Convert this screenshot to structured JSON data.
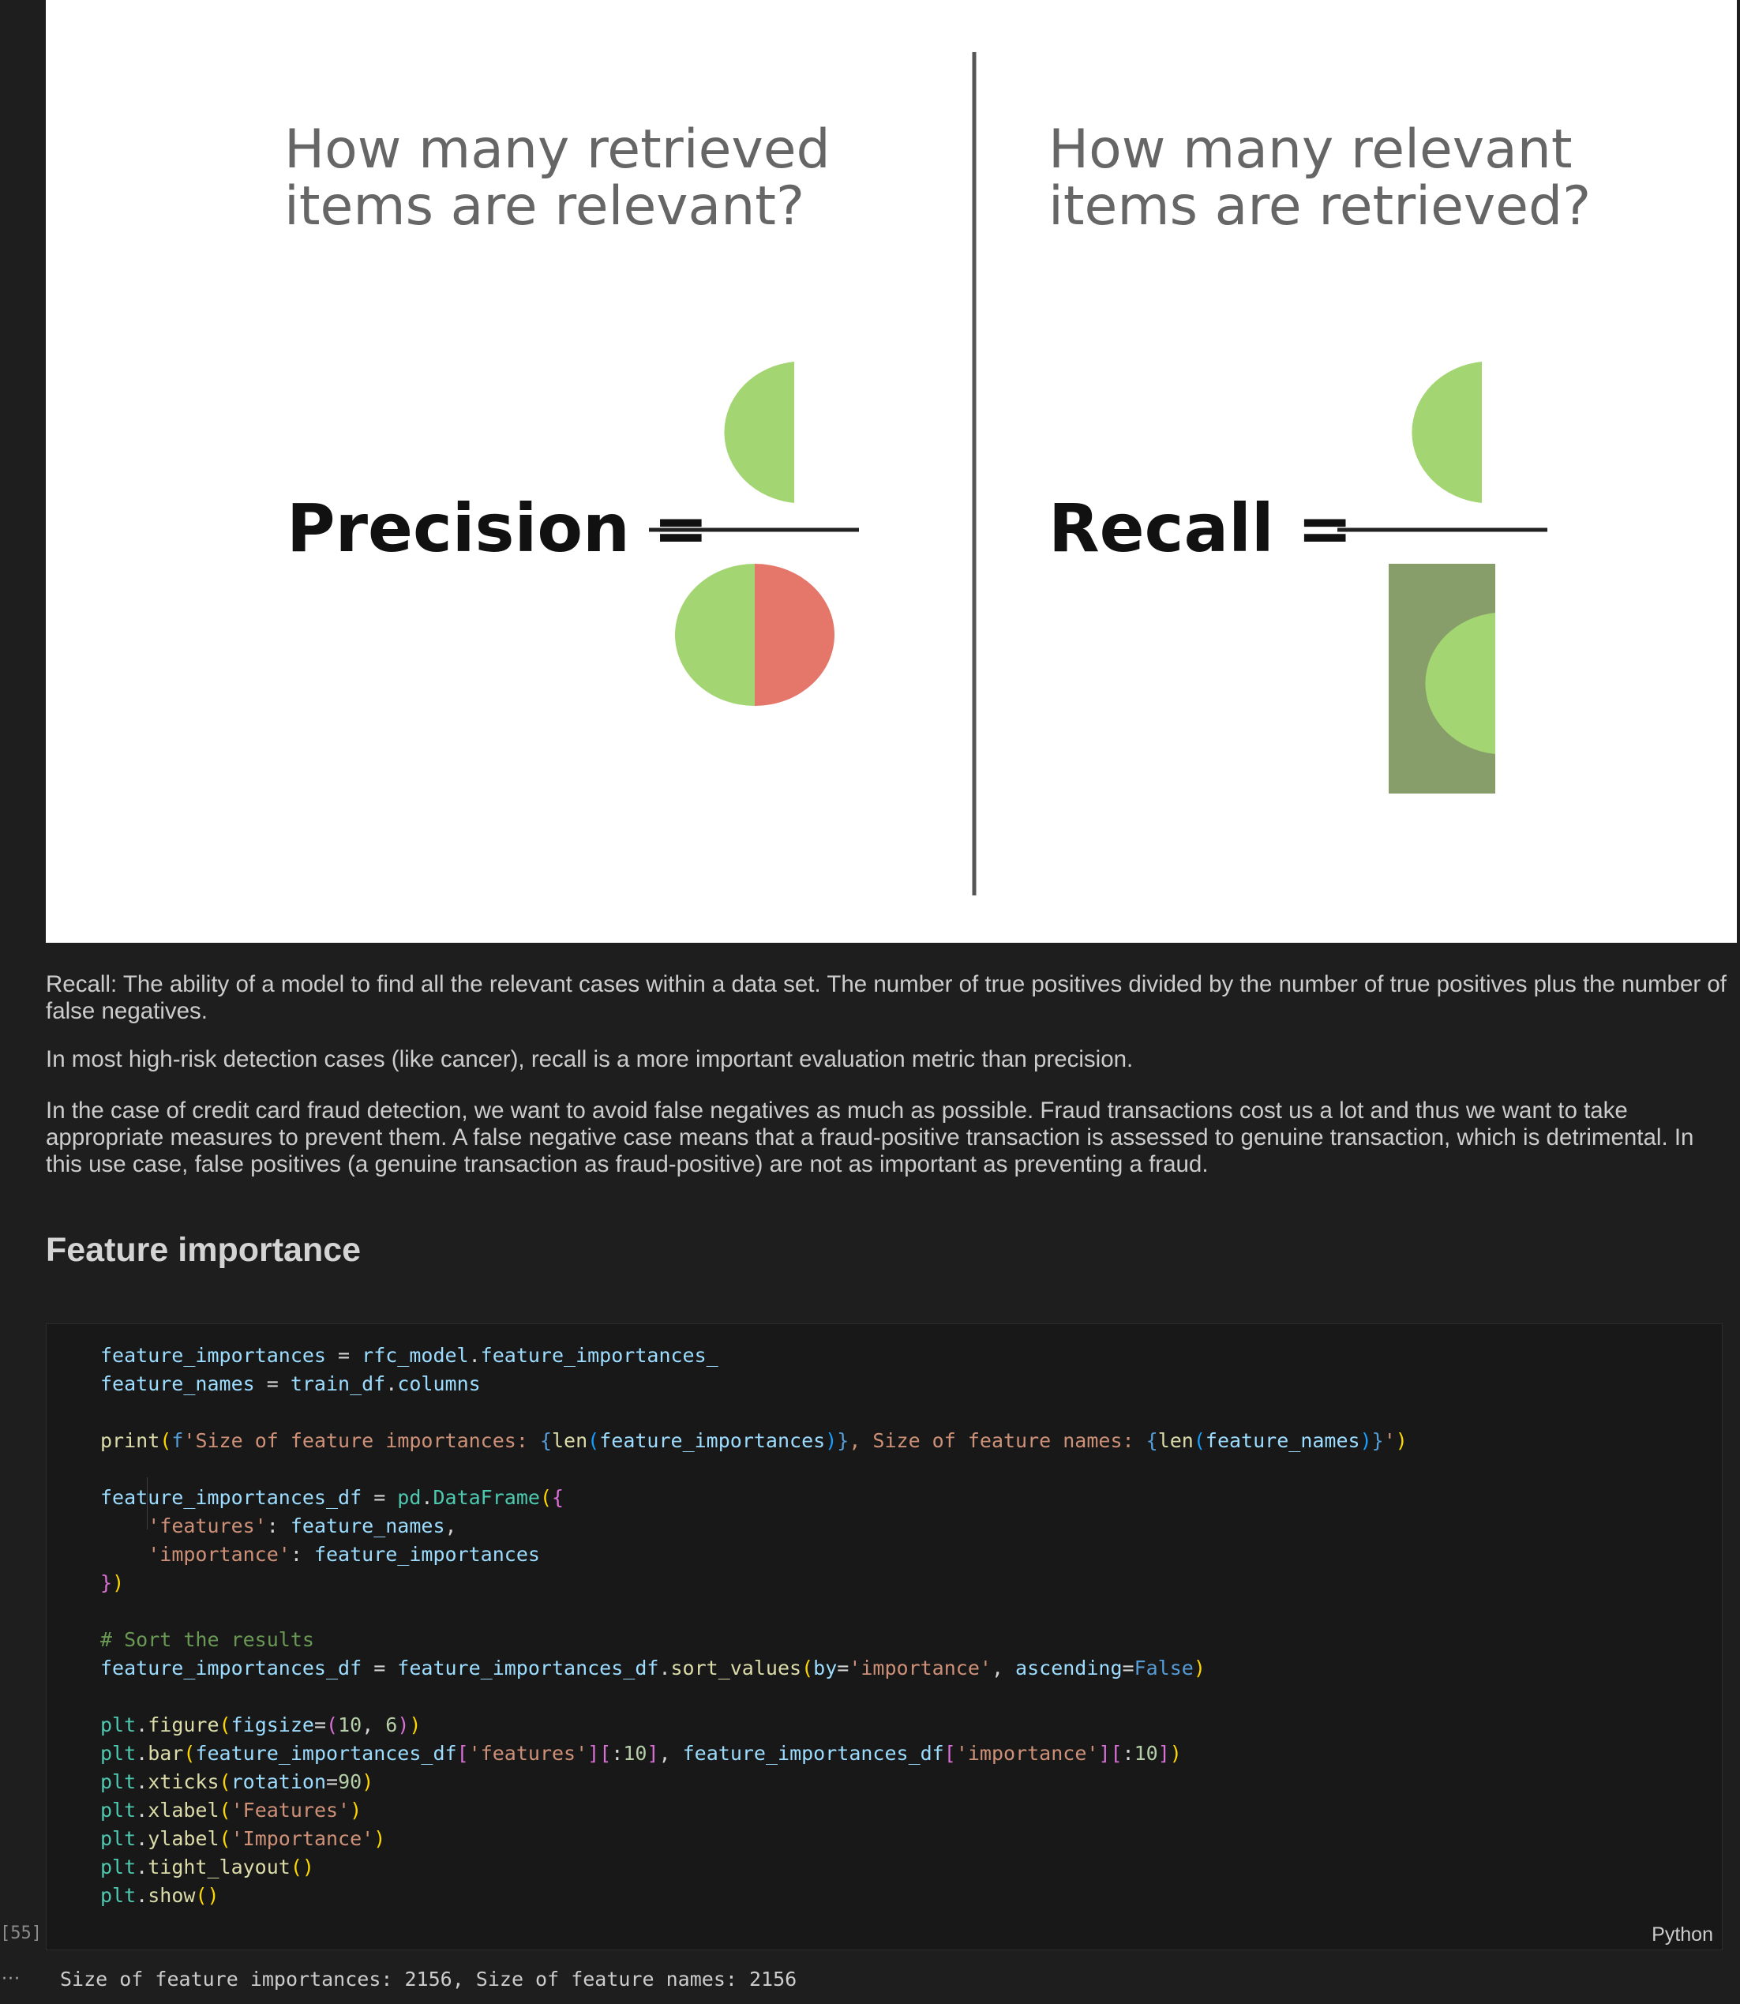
{
  "figure": {
    "left_question_line1": "How many retrieved",
    "left_question_line2": "items are relevant?",
    "right_question_line1": "How many relevant",
    "right_question_line2": "items are retrieved?",
    "precision_label": "Precision =",
    "recall_label": "Recall ="
  },
  "markdown": {
    "recall_definition": "Recall: The ability of a model to find all the relevant cases within a data set. The number of true positives divided by the number of true positives plus the number of false negatives.",
    "high_risk_note": "In most high-risk detection cases (like cancer), recall is a more important evaluation metric than precision.",
    "fraud_note": "In the case of credit card fraud detection, we want to avoid false negatives as much as possible. Fraud transactions cost us a lot and thus we want to take appropriate measures to prevent them. A false negative case means that a fraud-positive transaction is assessed to genuine transaction, which is detrimental. In this use case, false positives (a genuine transaction as fraud-positive) are not as important as preventing a fraud.",
    "section_heading": "Feature importance"
  },
  "code_cell": {
    "execution_count": "[55]",
    "language": "Python",
    "output_collapse": "···",
    "output_text": "Size of feature importances: 2156, Size of feature names: 2156"
  }
}
